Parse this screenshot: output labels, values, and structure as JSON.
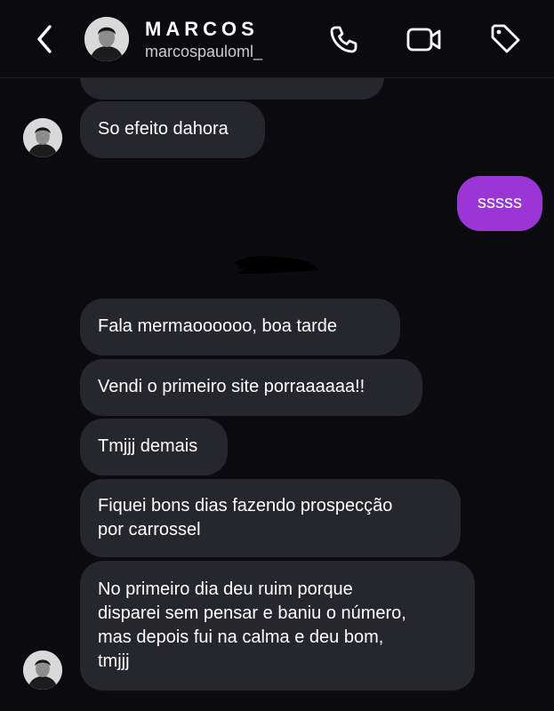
{
  "header": {
    "contact_name": "MARCOS",
    "contact_handle": "marcospauloml_",
    "icons": [
      "chevron-left-icon",
      "avatar",
      "phone-icon",
      "video-camera-icon",
      "tag-icon"
    ]
  },
  "messages": [
    {
      "from": "contact",
      "text": "So efeito dahora"
    },
    {
      "from": "me",
      "text": "sssss"
    },
    {
      "from": "contact",
      "text": "Fala mermaoooooo, boa tarde"
    },
    {
      "from": "contact",
      "text": "Vendi o primeiro site porraaaaaa!!"
    },
    {
      "from": "contact",
      "text": "Tmjjj demais"
    },
    {
      "from": "contact",
      "lines": [
        "Fiquei bons dias fazendo prospecção",
        "por carrossel"
      ]
    },
    {
      "from": "contact",
      "lines": [
        "No primeiro dia deu ruim porque",
        "disparei sem pensar e baniu o número,",
        "mas depois fui na calma e deu bom,",
        "tmjjj"
      ]
    }
  ],
  "colors": {
    "background": "#0b0b0f",
    "incoming_bubble": "#26272c",
    "outgoing_bubble": "#9a36d6",
    "text": "#ffffff",
    "handle_text": "#c9c9cf"
  }
}
